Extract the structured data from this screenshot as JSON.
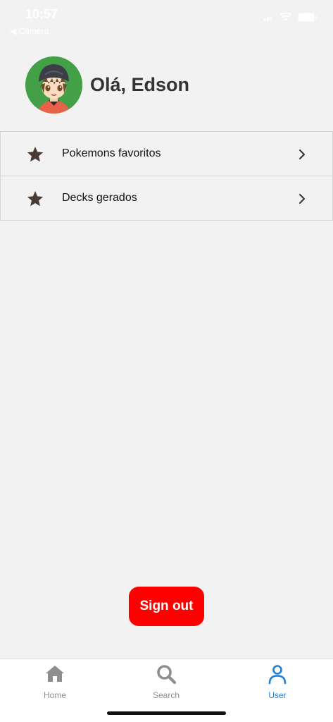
{
  "status_bar": {
    "time": "10:57",
    "back_label": "◀ Câmera"
  },
  "header": {
    "greeting": "Olá, Edson"
  },
  "menu": {
    "items": [
      {
        "label": "Pokemons favoritos",
        "icon": "star-icon"
      },
      {
        "label": "Decks gerados",
        "icon": "star-icon"
      }
    ]
  },
  "actions": {
    "signout_label": "Sign out"
  },
  "tabbar": {
    "tabs": [
      {
        "label": "Home",
        "icon": "home-icon",
        "active": false
      },
      {
        "label": "Search",
        "icon": "search-icon",
        "active": false
      },
      {
        "label": "User",
        "icon": "user-icon",
        "active": true
      }
    ]
  },
  "colors": {
    "background": "#f2f2f2",
    "signout": "#ff0000",
    "tab_active": "#1e7fd8",
    "tab_inactive": "#8e8e8e",
    "star": "#4a3a34",
    "avatar_ring": "#43a047"
  }
}
